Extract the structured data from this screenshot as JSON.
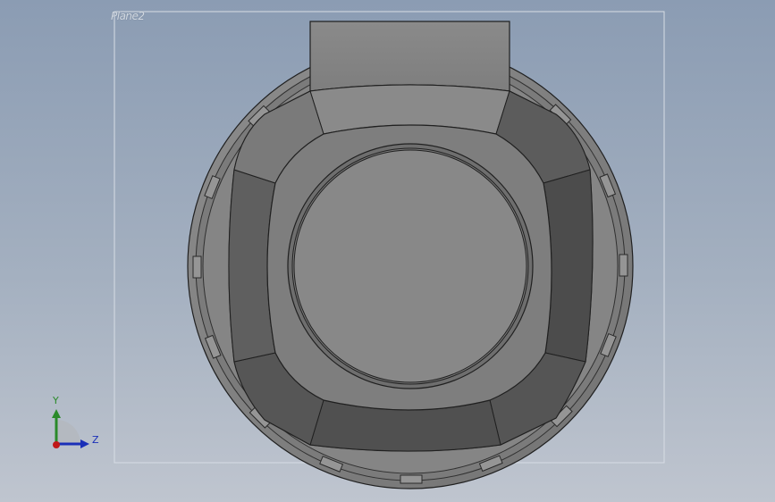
{
  "viewport": {
    "plane_label": "Plane2",
    "background_top": "#8b9cb3",
    "background_bottom": "#bfc5cf"
  },
  "model": {
    "description_icon": "revolved-part-model",
    "face_color_light": "#8a8a8a",
    "face_color_mid": "#777777",
    "face_color_dark": "#4f4f4f",
    "edge_color": "#202020"
  },
  "triad": {
    "y_label": "Y",
    "z_label": "Z",
    "y_color": "#2a8a2a",
    "z_color": "#1a2fb8",
    "origin_color": "#c01818"
  }
}
